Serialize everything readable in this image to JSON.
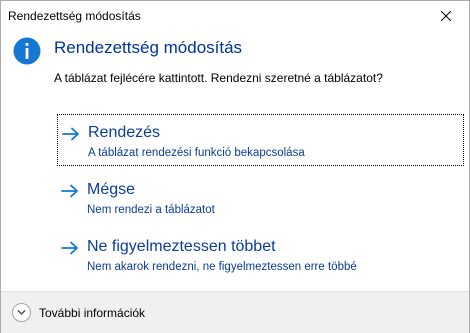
{
  "window": {
    "title": "Rendezettség módosítás"
  },
  "dialog": {
    "main_instruction": "Rendezettség módosítás",
    "content": "A táblázat fejlécére kattintott. Rendezni szeretné a táblázatot?",
    "commands": [
      {
        "label": "Rendezés",
        "note": "A táblázat rendezési funkció bekapcsolása"
      },
      {
        "label": "Mégse",
        "note": "Nem rendezi a táblázatot"
      },
      {
        "label": "Ne figyelmeztessen többet",
        "note": "Nem akarok rendezni, ne figyelmeztessen erre többé"
      }
    ]
  },
  "footer": {
    "details_label": "További információk"
  },
  "colors": {
    "accent": "#1677d2",
    "link": "#0b3c9a",
    "heading": "#003399",
    "footer_bg": "#f0f0f0"
  },
  "icons": {
    "info": "info-icon",
    "close": "close-icon",
    "arrow": "arrow-right-icon",
    "expand": "chevron-down-icon"
  }
}
